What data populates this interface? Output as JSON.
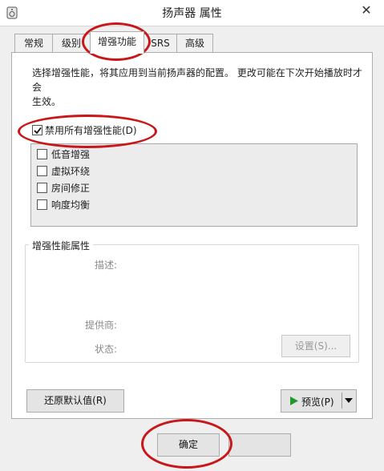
{
  "window": {
    "title": "扬声器 属性",
    "close_glyph": "✕"
  },
  "tabs": [
    {
      "label": "常规",
      "active": false
    },
    {
      "label": "级别",
      "active": false
    },
    {
      "label": "增强功能",
      "active": true
    },
    {
      "label": "SRS",
      "active": false
    },
    {
      "label": "高级",
      "active": false
    }
  ],
  "description_lines": [
    "选择增强性能，将其应用到当前扬声器的配置。 更改可能在下次开始播放时才会",
    "生效。"
  ],
  "disable_all": {
    "label": "禁用所有增强性能(D)",
    "checked": true
  },
  "enhancements": [
    {
      "label": "低音增强",
      "checked": false
    },
    {
      "label": "虚拟环绕",
      "checked": false
    },
    {
      "label": "房间修正",
      "checked": false
    },
    {
      "label": "响度均衡",
      "checked": false
    }
  ],
  "properties_group": {
    "title": "增强性能属性",
    "description_label": "描述:",
    "provider_label": "提供商:",
    "status_label": "状态:",
    "settings_button": "设置(S)..."
  },
  "restore_button": "还原默认值(R)",
  "preview_button": "预览(P)",
  "ok_button": "确定",
  "colors": {
    "annotation": "#c81619",
    "play_icon": "#1f9a2a"
  }
}
